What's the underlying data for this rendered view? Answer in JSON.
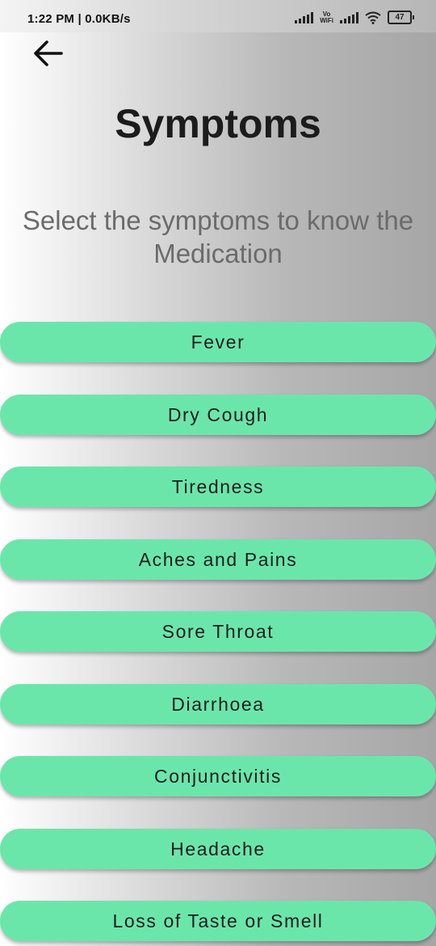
{
  "status_bar": {
    "time": "1:22 PM | 0.0KB/s",
    "volte_top": "Vo",
    "volte_bottom": "WiFi",
    "battery": "47",
    "icons": [
      "signal-icon",
      "vowifi-icon",
      "signal-icon",
      "wifi-icon",
      "battery-icon"
    ]
  },
  "header": {
    "back_icon": "arrow-left-icon",
    "title": "Symptoms",
    "subtitle": "Select the symptoms to know the Medication"
  },
  "symptoms": [
    {
      "label": "Fever"
    },
    {
      "label": "Dry Cough"
    },
    {
      "label": "Tiredness"
    },
    {
      "label": "Aches and Pains"
    },
    {
      "label": "Sore Throat"
    },
    {
      "label": "Diarrhoea"
    },
    {
      "label": "Conjunctivitis"
    },
    {
      "label": "Headache"
    },
    {
      "label": "Loss of Taste or Smell"
    }
  ],
  "colors": {
    "button_bg": "#6be6ab",
    "title_text": "#1c1c1c",
    "subtitle_text": "#6b6b6b"
  }
}
